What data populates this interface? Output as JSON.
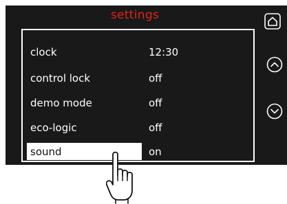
{
  "colors": {
    "screen_bg": "#191919",
    "title": "#e2231a",
    "text": "#ffffff",
    "highlight_bg": "#ffffff",
    "highlight_text": "#111111"
  },
  "header": {
    "title": "settings"
  },
  "menu": {
    "items": [
      {
        "label": "clock",
        "value": "12:30"
      },
      {
        "label": "control lock",
        "value": "off"
      },
      {
        "label": "demo mode",
        "value": "off"
      },
      {
        "label": "eco-logic",
        "value": "off"
      },
      {
        "label": "sound",
        "value": "on",
        "selected": true
      }
    ]
  },
  "icons": {
    "home": "home-icon",
    "up": "chevron-up-circle-icon",
    "down": "chevron-down-circle-icon",
    "pointer": "pointing-hand-icon"
  }
}
